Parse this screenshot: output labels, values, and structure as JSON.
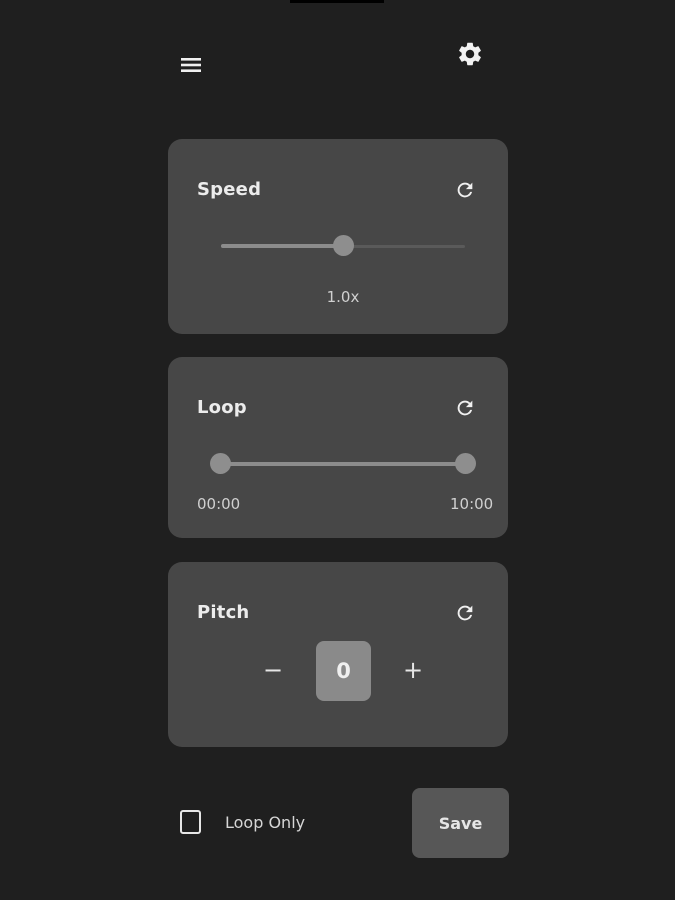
{
  "colors": {
    "background": "#1f1f1f",
    "card": "#474747",
    "accent_thumb": "#8e8e8e",
    "text": "#e6e6e6"
  },
  "header": {
    "menu_icon": "hamburger-menu-icon",
    "settings_icon": "gear-icon"
  },
  "speed": {
    "title": "Speed",
    "reset_icon": "refresh-icon",
    "value": 1.0,
    "min": 0.0,
    "max": 2.0,
    "value_label": "1.0x"
  },
  "loop": {
    "title": "Loop",
    "reset_icon": "refresh-icon",
    "start_fraction": 0.0,
    "end_fraction": 1.0,
    "start_label": "00:00",
    "end_label": "10:00"
  },
  "pitch": {
    "title": "Pitch",
    "reset_icon": "refresh-icon",
    "minus_label": "−",
    "value": "0",
    "plus_label": "+"
  },
  "footer": {
    "loop_only_label": "Loop Only",
    "loop_only_checked": false,
    "save_label": "Save"
  }
}
